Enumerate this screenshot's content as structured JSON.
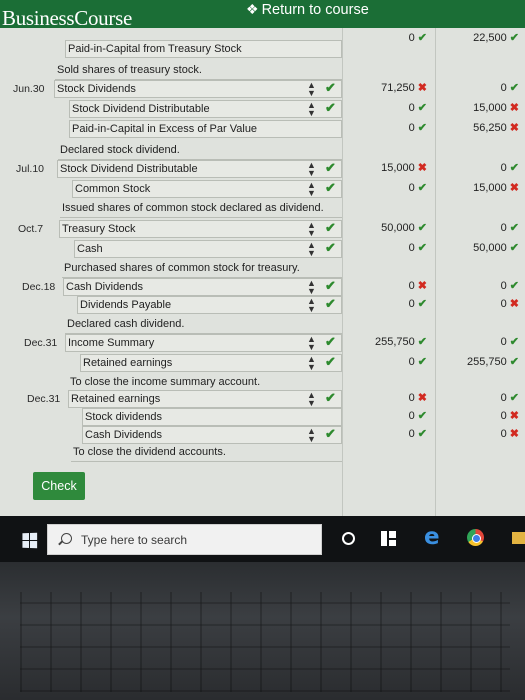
{
  "app": {
    "brand": "BusinessCourse",
    "return_link": "Return to course"
  },
  "journal": {
    "rows": [
      {
        "date": "",
        "account": "Paid-in-Capital from Treasury Stock",
        "debit": "",
        "debit_mark": "",
        "credit": "",
        "credit_mark": "",
        "has_arrows": false,
        "row_check": false
      },
      {
        "date": "",
        "account": "",
        "debit": "0",
        "debit_mark": "check",
        "credit": "22,500",
        "credit_mark": "check",
        "has_arrows": false,
        "row_check": false
      },
      {
        "date": "",
        "account": "Sold shares of treasury stock.",
        "type": "note"
      },
      {
        "date": "Jun.30",
        "account": "Stock Dividends",
        "debit": "71,250",
        "debit_mark": "x",
        "credit": "0",
        "credit_mark": "check",
        "has_arrows": true,
        "row_check": true
      },
      {
        "date": "",
        "account": "Stock Dividend Distributable",
        "debit": "0",
        "debit_mark": "check",
        "credit": "15,000",
        "credit_mark": "x",
        "has_arrows": true,
        "row_check": true
      },
      {
        "date": "",
        "account": "Paid-in-Capital in Excess of Par Value",
        "debit": "0",
        "debit_mark": "check",
        "credit": "56,250",
        "credit_mark": "x",
        "has_arrows": false,
        "row_check": false
      },
      {
        "date": "",
        "account": "Declared stock dividend.",
        "type": "note"
      },
      {
        "date": "Jul.10",
        "account": "Stock Dividend Distributable",
        "debit": "15,000",
        "debit_mark": "x",
        "credit": "0",
        "credit_mark": "check",
        "has_arrows": true,
        "row_check": true
      },
      {
        "date": "",
        "account": "Common Stock",
        "debit": "0",
        "debit_mark": "check",
        "credit": "15,000",
        "credit_mark": "x",
        "has_arrows": true,
        "row_check": true
      },
      {
        "date": "",
        "account": "Issued shares of common stock declared as dividend.",
        "type": "note"
      },
      {
        "date": "Oct.7",
        "account": "Treasury Stock",
        "debit": "50,000",
        "debit_mark": "check",
        "credit": "0",
        "credit_mark": "check",
        "has_arrows": true,
        "row_check": true
      },
      {
        "date": "",
        "account": "Cash",
        "debit": "0",
        "debit_mark": "check",
        "credit": "50,000",
        "credit_mark": "check",
        "has_arrows": true,
        "row_check": true
      },
      {
        "date": "",
        "account": "Purchased shares of common stock for treasury.",
        "type": "note"
      },
      {
        "date": "Dec.18",
        "account": "Cash Dividends",
        "debit": "0",
        "debit_mark": "x",
        "credit": "0",
        "credit_mark": "check",
        "has_arrows": true,
        "row_check": true
      },
      {
        "date": "",
        "account": "Dividends Payable",
        "debit": "0",
        "debit_mark": "check",
        "credit": "0",
        "credit_mark": "x",
        "has_arrows": true,
        "row_check": true
      },
      {
        "date": "",
        "account": "Declared cash dividend.",
        "type": "note"
      },
      {
        "date": "Dec.31",
        "account": "Income Summary",
        "debit": "255,750",
        "debit_mark": "check",
        "credit": "0",
        "credit_mark": "check",
        "has_arrows": true,
        "row_check": true
      },
      {
        "date": "",
        "account": "Retained earnings",
        "debit": "0",
        "debit_mark": "check",
        "credit": "255,750",
        "credit_mark": "check",
        "has_arrows": true,
        "row_check": true
      },
      {
        "date": "",
        "account": "To close the income summary account.",
        "type": "note"
      },
      {
        "date": "Dec.31",
        "account": "Retained earnings",
        "debit": "0",
        "debit_mark": "x",
        "credit": "0",
        "credit_mark": "check",
        "has_arrows": true,
        "row_check": true
      },
      {
        "date": "",
        "account": "Stock dividends",
        "debit": "0",
        "debit_mark": "check",
        "credit": "0",
        "credit_mark": "x",
        "has_arrows": false,
        "row_check": false
      },
      {
        "date": "",
        "account": "Cash Dividends",
        "debit": "0",
        "debit_mark": "check",
        "credit": "0",
        "credit_mark": "x",
        "has_arrows": true,
        "row_check": true
      },
      {
        "date": "",
        "account": "To close the dividend accounts.",
        "type": "note"
      }
    ]
  },
  "check_button": "Check",
  "taskbar": {
    "search_placeholder": "Type here to search"
  },
  "colors": {
    "brand_green": "#1b6e36",
    "check_green": "#2e8a2e",
    "error_red": "#d22a20",
    "button_green": "#2f8a3c"
  }
}
